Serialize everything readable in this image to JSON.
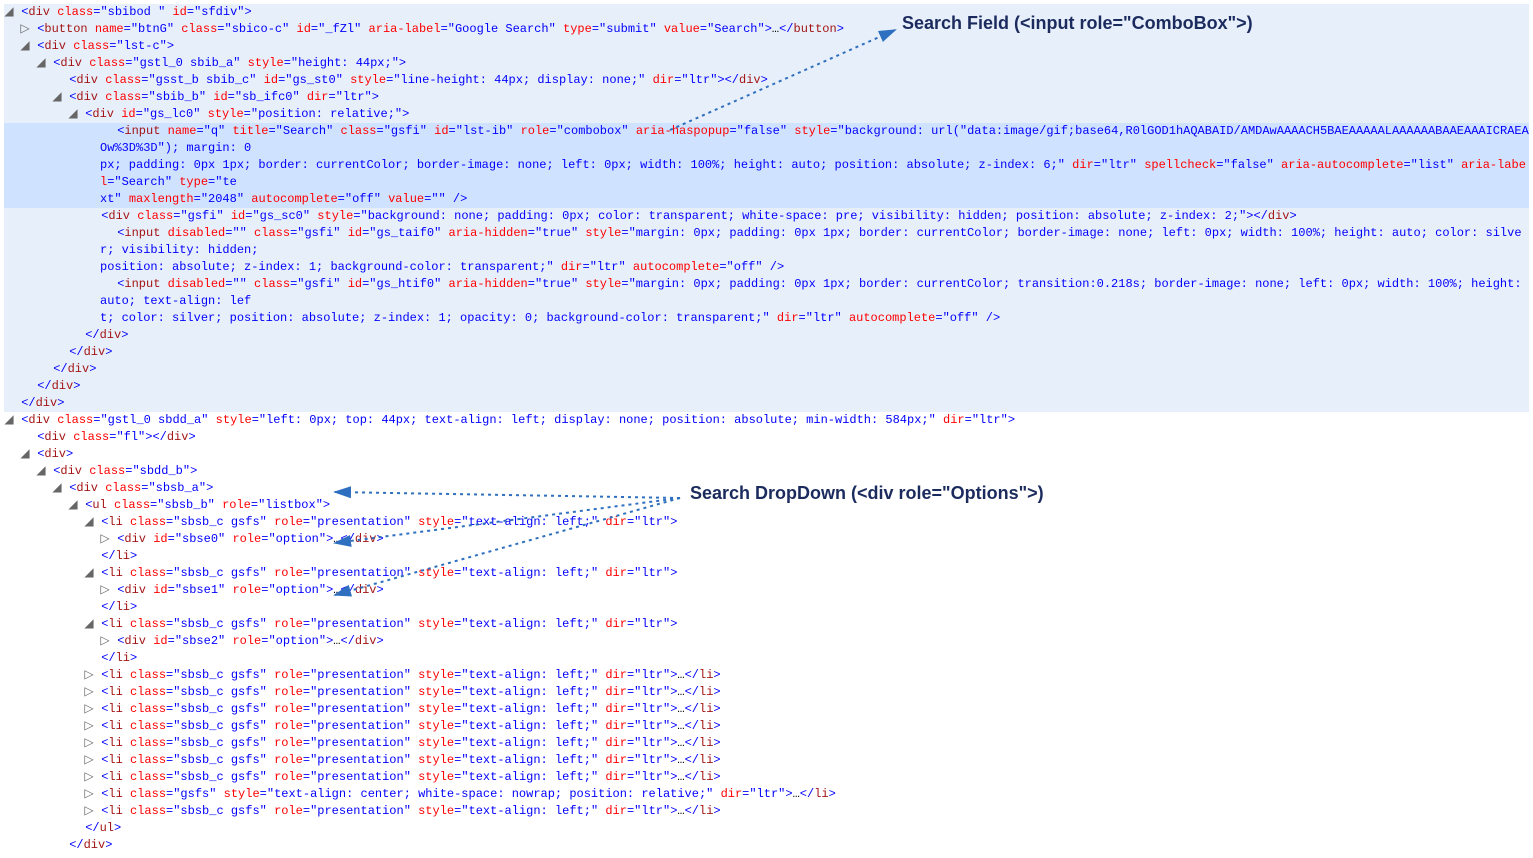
{
  "callouts": {
    "search_field": "Search Field (<input role=\"ComboBox\">)",
    "search_dropdown": "Search DropDown (<div role=\"Options\">)"
  },
  "code": {
    "l1": {
      "class_": "sbibod ",
      "id_": "sfdiv"
    },
    "l2": {
      "name_": "btnG",
      "class_": "sbico-c",
      "id_": "_fZl",
      "aria_label": "Google Search",
      "type_": "submit",
      "value_": "Search"
    },
    "l3": {
      "class_": "lst-c"
    },
    "l4": {
      "class_": "gstl_0 sbib_a",
      "style_": "height: 44px;"
    },
    "l5": {
      "class_": "gsst_b sbib_c",
      "id_": "gs_st0",
      "style_": "line-height: 44px; display: none;",
      "dir_": "ltr"
    },
    "l6": {
      "class_": "sbib_b",
      "id_": "sb_ifc0",
      "dir_": "ltr"
    },
    "l7": {
      "id_": "gs_lc0",
      "style_": "position: relative;"
    },
    "l8": {
      "name_": "q",
      "title_": "Search",
      "class_": "gsfi",
      "id_": "lst-ib",
      "role_": "combobox",
      "aria_haspopup": "false",
      "style_a": "background: url(\"data:image/gif;base64,R0lGOD1hAQABAID/AMDAwAAAACH5BAEAAAAALAAAAAABAAEAAAICRAEAOw%3D%3D\"); margin: 0",
      "style_b": "px; padding: 0px 1px; border: currentColor; border-image: none; left: 0px; width: 100%; height: auto; position: absolute; z-index: 6;",
      "dir_": "ltr",
      "spellcheck_": "false",
      "aria_autocomplete": "list",
      "aria_label": "Search",
      "type_": "te",
      "type_rest": "xt",
      "maxlength_": "2048",
      "autocomplete_": "off",
      "value_": ""
    },
    "l9": {
      "class_": "gsfi",
      "id_": "gs_sc0",
      "style_": "background: none; padding: 0px; color: transparent; white-space: pre; visibility: hidden; position: absolute; z-index: 2;"
    },
    "l10": {
      "disabled_": "",
      "class_": "gsfi",
      "id_": "gs_taif0",
      "aria_hidden": "true",
      "style_a": "margin: 0px; padding: 0px 1px; border: currentColor; border-image: none; left: 0px; width: 100%; height: auto; color: silver; visibility: hidden;",
      "style_b": "position: absolute; z-index: 1; background-color: transparent;",
      "dir_": "ltr",
      "autocomplete_": "off"
    },
    "l11": {
      "disabled_": "",
      "class_": "gsfi",
      "id_": "gs_htif0",
      "aria_hidden": "true",
      "style_a": "margin: 0px; padding: 0px 1px; border: currentColor; transition:0.218s; border-image: none; left: 0px; width: 100%; height: auto; text-align: lef",
      "style_b": "t; color: silver; position: absolute; z-index: 1; opacity: 0; background-color: transparent;",
      "dir_": "ltr",
      "autocomplete_": "off"
    },
    "dd": {
      "class_": "gstl_0 sbdd_a",
      "style_": "left: 0px; top: 44px; text-align: left; display: none; position: absolute; min-width: 584px;",
      "dir_": "ltr"
    },
    "fl": {
      "class_": "fl"
    },
    "sbdd_b": {
      "class_": "sbdd_b"
    },
    "sbsb_a": {
      "class_": "sbsb_a"
    },
    "ul": {
      "class_": "sbsb_b",
      "role_": "listbox"
    },
    "li": {
      "class_": "sbsb_c gsfs",
      "role_": "presentation",
      "style_": "text-align: left;",
      "dir_": "ltr"
    },
    "li_center": {
      "class_": "gsfs",
      "style_": "text-align: center; white-space: nowrap; position: relative;",
      "dir_": "ltr"
    },
    "opt0": {
      "id_": "sbse0",
      "role_": "option"
    },
    "opt1": {
      "id_": "sbse1",
      "role_": "option"
    },
    "opt2": {
      "id_": "sbse2",
      "role_": "option"
    }
  }
}
